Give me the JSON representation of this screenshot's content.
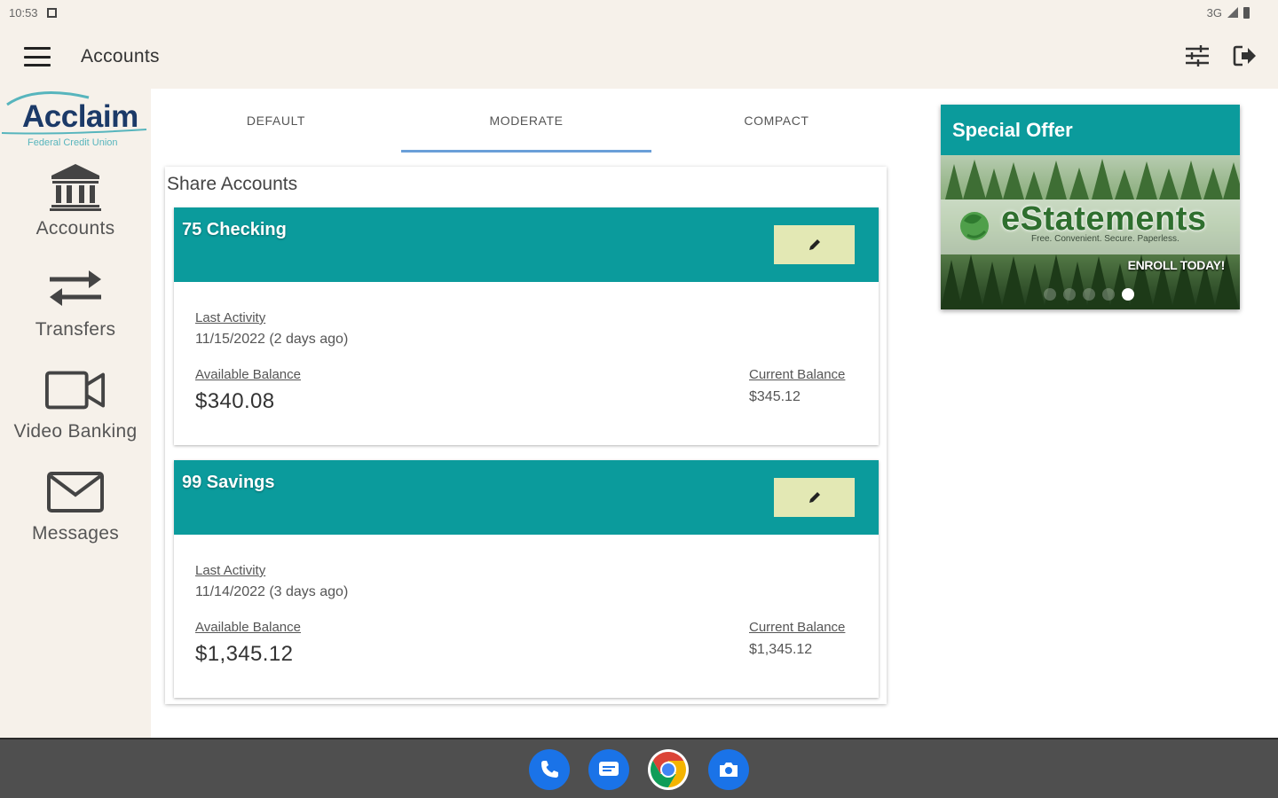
{
  "status_bar": {
    "time": "10:53",
    "network": "3G"
  },
  "app_bar": {
    "title": "Accounts"
  },
  "logo": {
    "name": "Acclaim",
    "subtitle": "Federal Credit Union"
  },
  "nav": [
    {
      "label": "Accounts",
      "icon": "bank-icon"
    },
    {
      "label": "Transfers",
      "icon": "transfer-arrows-icon"
    },
    {
      "label": "Video Banking",
      "icon": "video-camera-icon"
    },
    {
      "label": "Messages",
      "icon": "envelope-icon"
    }
  ],
  "tabs": [
    {
      "label": "DEFAULT",
      "active": false
    },
    {
      "label": "MODERATE",
      "active": true
    },
    {
      "label": "COMPACT",
      "active": false
    }
  ],
  "share_accounts": {
    "title": "Share Accounts",
    "accounts": [
      {
        "name": "75 Checking",
        "last_activity_label": "Last Activity",
        "last_activity": "11/15/2022 (2 days ago)",
        "available_label": "Available Balance",
        "available": "$340.08",
        "current_label": "Current Balance",
        "current": "$345.12"
      },
      {
        "name": "99 Savings",
        "last_activity_label": "Last Activity",
        "last_activity": "11/14/2022 (3 days ago)",
        "available_label": "Available Balance",
        "available": "$1,345.12",
        "current_label": "Current Balance",
        "current": "$1,345.12"
      }
    ]
  },
  "special_offer": {
    "title": "Special Offer",
    "brand": "eStatements",
    "tagline": "Free. Convenient. Secure. Paperless.",
    "cta": "ENROLL TODAY!",
    "slide_count": 5,
    "active_slide": 5
  },
  "taskbar": {
    "apps": [
      "phone-icon",
      "messages-app-icon",
      "chrome-icon",
      "camera-icon"
    ]
  },
  "colors": {
    "teal": "#0b9b9c",
    "cream": "#f6f1ea",
    "edit_button": "#e3e8b4",
    "tab_indicator": "#6a9fd8",
    "navy": "#1c3a68"
  }
}
